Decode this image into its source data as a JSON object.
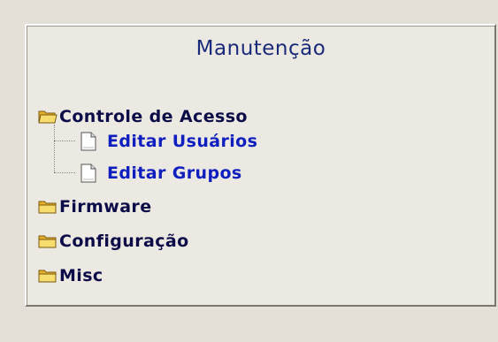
{
  "panel": {
    "title": "Manutenção"
  },
  "tree": {
    "items": [
      {
        "label": "Controle de Acesso",
        "icon": "folder-open-icon",
        "children": [
          {
            "label": "Editar Usuários",
            "icon": "document-icon"
          },
          {
            "label": "Editar Grupos",
            "icon": "document-icon"
          }
        ]
      },
      {
        "label": "Firmware",
        "icon": "folder-icon"
      },
      {
        "label": "Configuração",
        "icon": "folder-icon"
      },
      {
        "label": "Misc",
        "icon": "folder-icon"
      }
    ]
  },
  "colors": {
    "background": "#e5e0d7",
    "panel": "#ece9e2",
    "title": "#1a2a7a",
    "folder_label": "#0b0b48",
    "link_label": "#0f1fbf",
    "folder_fill": "#f3d05a"
  }
}
